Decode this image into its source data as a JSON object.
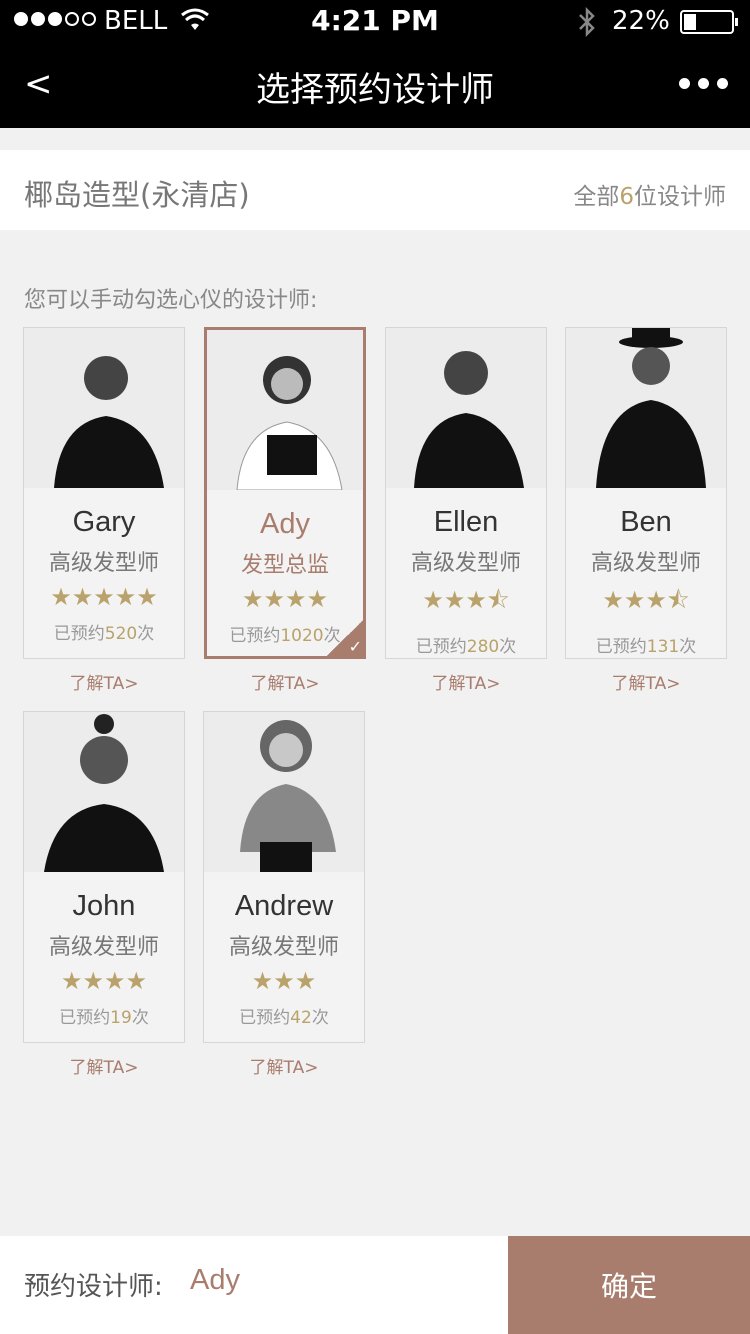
{
  "status": {
    "carrier": "BELL",
    "time": "4:21 PM",
    "battery": "22%"
  },
  "nav": {
    "back": "<",
    "title": "选择预约设计师"
  },
  "store": {
    "name": "椰岛造型(永清店)",
    "count_prefix": "全部",
    "count_num": "6",
    "count_suffix": "位设计师"
  },
  "hint": "您可以手动勾选心仪的设计师:",
  "designers": [
    {
      "name": "Gary",
      "title": "高级发型师",
      "stars": "★★★★★",
      "count_prefix": "已预约",
      "count": "520",
      "count_suffix": "次",
      "more": "了解TA>"
    },
    {
      "name": "Ady",
      "title": "发型总监",
      "stars": "★★★★",
      "count_prefix": "已预约",
      "count": "1020",
      "count_suffix": "次",
      "more": "了解TA>",
      "selected": true
    },
    {
      "name": "Ellen",
      "title": "高级发型师",
      "stars": "★★★⯪",
      "count_prefix": "已预约",
      "count": "280",
      "count_suffix": "次",
      "more": "了解TA>"
    },
    {
      "name": "Ben",
      "title": "高级发型师",
      "stars": "★★★⯪",
      "count_prefix": "已预约",
      "count": "131",
      "count_suffix": "次",
      "more": "了解TA>"
    },
    {
      "name": "John",
      "title": "高级发型师",
      "stars": "★★★★",
      "count_prefix": "已预约",
      "count": "19",
      "count_suffix": "次",
      "more": "了解TA>"
    },
    {
      "name": "Andrew",
      "title": "高级发型师",
      "stars": "★★★",
      "count_prefix": "已预约",
      "count": "42",
      "count_suffix": "次",
      "more": "了解TA>"
    }
  ],
  "bottom": {
    "label": "预约设计师:",
    "value": "Ady",
    "confirm": "确定"
  },
  "colors": {
    "accent": "#a97d6e",
    "gold": "#b9a26b"
  }
}
